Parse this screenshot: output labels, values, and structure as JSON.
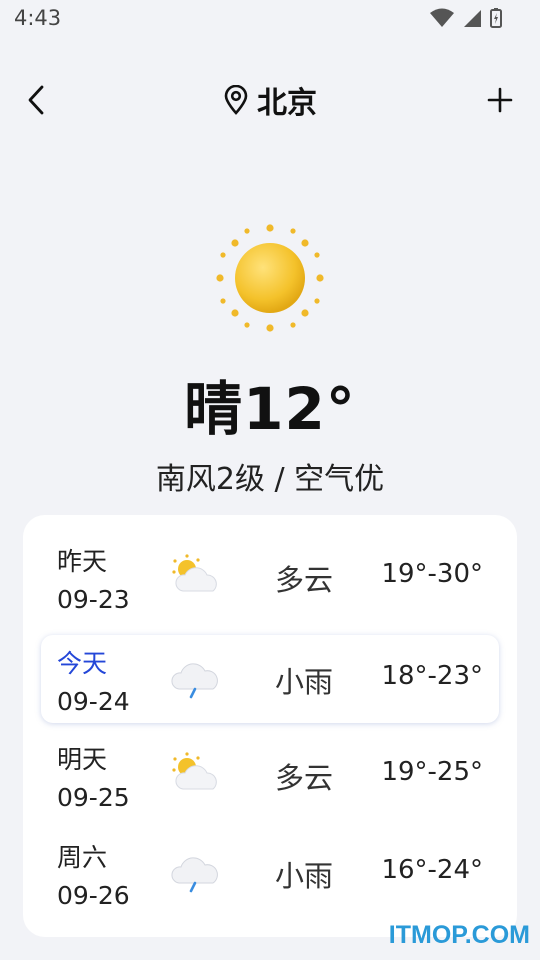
{
  "status_bar": {
    "time": "4:43"
  },
  "header": {
    "city": "北京"
  },
  "current": {
    "condition_temp": "晴12°",
    "details": "南风2级 / 空气优"
  },
  "forecast": [
    {
      "day": "昨天",
      "date": "09-23",
      "condition": "多云",
      "temp_range": "19°-30°",
      "icon": "partly-cloudy-icon"
    },
    {
      "day": "今天",
      "date": "09-24",
      "condition": "小雨",
      "temp_range": "18°-23°",
      "icon": "light-rain-icon"
    },
    {
      "day": "明天",
      "date": "09-25",
      "condition": "多云",
      "temp_range": "19°-25°",
      "icon": "partly-cloudy-icon"
    },
    {
      "day": "周六",
      "date": "09-26",
      "condition": "小雨",
      "temp_range": "16°-24°",
      "icon": "light-rain-icon"
    }
  ],
  "colors": {
    "accent": "#2447d8",
    "background": "#f2f3f7",
    "sun": "#f4c22b"
  },
  "watermark": "ITMOP.COM"
}
